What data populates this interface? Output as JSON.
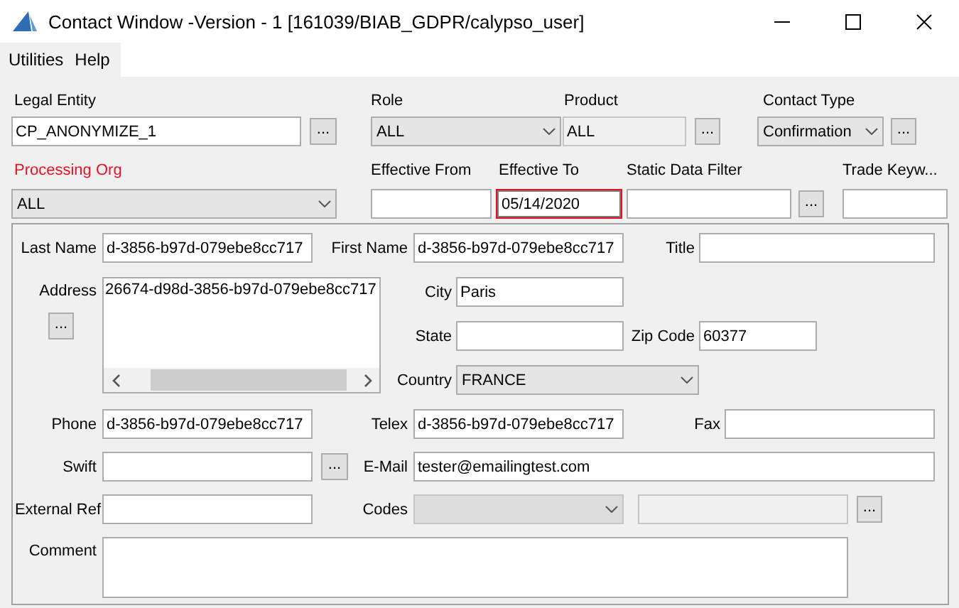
{
  "window": {
    "title": "Contact Window -Version - 1 [161039/BIAB_GDPR/calypso_user]"
  },
  "menu": [
    {
      "label": "Utilities"
    },
    {
      "label": "Help"
    }
  ],
  "legal_entity": {
    "label": "Legal Entity",
    "value": "CP_ANONYMIZE_1",
    "button": "..."
  },
  "role": {
    "label": "Role",
    "value": "ALL"
  },
  "product": {
    "label": "Product",
    "value": "ALL",
    "disabled": true,
    "button": "..."
  },
  "contact_type": {
    "label": "Contact Type",
    "value": "Confirmation",
    "button": "..."
  },
  "processing_org": {
    "label": "Processing Org",
    "required": true,
    "value": "ALL"
  },
  "effective_from": {
    "label": "Effective From"
  },
  "effective_to": {
    "label": "Effective To",
    "value": "05/14/2020",
    "highlighted": true
  },
  "static_data_filter": {
    "label": "Static Data Filter",
    "button": "..."
  },
  "trade_keywords": {
    "label": "Trade Keyw..."
  },
  "contact": {
    "last_name": {
      "label": "Last Name",
      "value": "d-3856-b97d-079ebe8cc717"
    },
    "first_name": {
      "label": "First Name",
      "value": "d-3856-b97d-079ebe8cc717"
    },
    "title": {
      "label": "Title"
    },
    "address": {
      "label": "Address",
      "value": "26674-d98d-3856-b97d-079ebe8cc717",
      "button": "..."
    },
    "city": {
      "label": "City",
      "value": "Paris"
    },
    "state": {
      "label": "State"
    },
    "zip_code": {
      "label": "Zip Code",
      "value": "60377"
    },
    "country": {
      "label": "Country",
      "value": "FRANCE"
    },
    "phone": {
      "label": "Phone",
      "value": "d-3856-b97d-079ebe8cc717"
    },
    "telex": {
      "label": "Telex",
      "value": "d-3856-b97d-079ebe8cc717"
    },
    "fax": {
      "label": "Fax"
    },
    "swift": {
      "label": "Swift",
      "button": "..."
    },
    "email": {
      "label": "E-Mail",
      "value": "tester@emailingtest.com"
    },
    "external_ref": {
      "label": "External Ref"
    },
    "codes": {
      "label": "Codes",
      "disabled": true,
      "button": "..."
    },
    "comment": {
      "label": "Comment"
    }
  }
}
